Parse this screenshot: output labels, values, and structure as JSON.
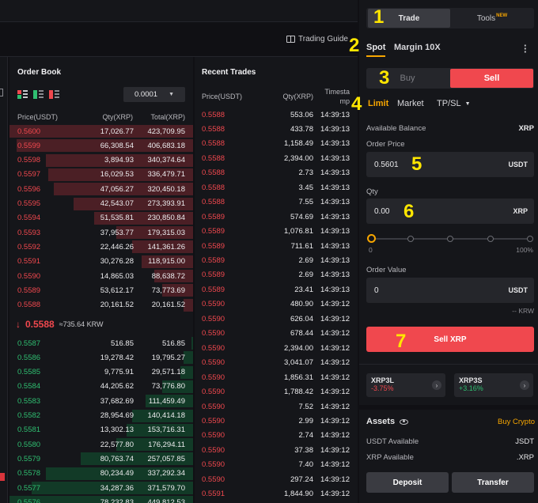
{
  "header": {
    "trading_guide": "Trading Guide"
  },
  "callouts": [
    "1",
    "2",
    "3",
    "4",
    "5",
    "6",
    "7"
  ],
  "order_book": {
    "title": "Order Book",
    "precision": "0.0001",
    "headers": {
      "price": "Price(USDT)",
      "qty": "Qty(XRP)",
      "total": "Total(XRP)"
    },
    "asks": [
      {
        "price": "0.5600",
        "qty": "17,026.77",
        "total": "423,709.95",
        "depth": 1.0
      },
      {
        "price": "0.5599",
        "qty": "66,308.54",
        "total": "406,683.18",
        "depth": 0.96
      },
      {
        "price": "0.5598",
        "qty": "3,894.93",
        "total": "340,374.64",
        "depth": 0.8
      },
      {
        "price": "0.5597",
        "qty": "16,029.53",
        "total": "336,479.71",
        "depth": 0.79
      },
      {
        "price": "0.5596",
        "qty": "47,056.27",
        "total": "320,450.18",
        "depth": 0.76
      },
      {
        "price": "0.5595",
        "qty": "42,543.07",
        "total": "273,393.91",
        "depth": 0.65
      },
      {
        "price": "0.5594",
        "qty": "51,535.81",
        "total": "230,850.84",
        "depth": 0.54
      },
      {
        "price": "0.5593",
        "qty": "37,953.77",
        "total": "179,315.03",
        "depth": 0.42
      },
      {
        "price": "0.5592",
        "qty": "22,446.26",
        "total": "141,361.26",
        "depth": 0.33
      },
      {
        "price": "0.5591",
        "qty": "30,276.28",
        "total": "118,915.00",
        "depth": 0.28
      },
      {
        "price": "0.5590",
        "qty": "14,865.03",
        "total": "88,638.72",
        "depth": 0.21
      },
      {
        "price": "0.5589",
        "qty": "53,612.17",
        "total": "73,773.69",
        "depth": 0.17
      },
      {
        "price": "0.5588",
        "qty": "20,161.52",
        "total": "20,161.52",
        "depth": 0.05
      }
    ],
    "last_price": "0.5588",
    "last_price_fiat": "≈735.64 KRW",
    "bids": [
      {
        "price": "0.5587",
        "qty": "516.85",
        "total": "516.85",
        "depth": 0.01
      },
      {
        "price": "0.5586",
        "qty": "19,278.42",
        "total": "19,795.27",
        "depth": 0.05
      },
      {
        "price": "0.5585",
        "qty": "9,775.91",
        "total": "29,571.18",
        "depth": 0.07
      },
      {
        "price": "0.5584",
        "qty": "44,205.62",
        "total": "73,776.80",
        "depth": 0.17
      },
      {
        "price": "0.5583",
        "qty": "37,682.69",
        "total": "111,459.49",
        "depth": 0.26
      },
      {
        "price": "0.5582",
        "qty": "28,954.69",
        "total": "140,414.18",
        "depth": 0.33
      },
      {
        "price": "0.5581",
        "qty": "13,302.13",
        "total": "153,716.31",
        "depth": 0.36
      },
      {
        "price": "0.5580",
        "qty": "22,577.80",
        "total": "176,294.11",
        "depth": 0.42
      },
      {
        "price": "0.5579",
        "qty": "80,763.74",
        "total": "257,057.85",
        "depth": 0.61
      },
      {
        "price": "0.5578",
        "qty": "80,234.49",
        "total": "337,292.34",
        "depth": 0.8
      },
      {
        "price": "0.5577",
        "qty": "34,287.36",
        "total": "371,579.70",
        "depth": 0.88
      },
      {
        "price": "0.5576",
        "qty": "78,232.83",
        "total": "449,812.53",
        "depth": 1.0
      }
    ]
  },
  "recent_trades": {
    "title": "Recent Trades",
    "headers": {
      "price": "Price(USDT)",
      "qty": "Qty(XRP)",
      "time_line1": "Timesta",
      "time_line2": "mp"
    },
    "rows": [
      {
        "price": "0.5588",
        "qty": "553.06",
        "time": "14:39:13",
        "side": "sell"
      },
      {
        "price": "0.5588",
        "qty": "433.78",
        "time": "14:39:13",
        "side": "sell"
      },
      {
        "price": "0.5588",
        "qty": "1,158.49",
        "time": "14:39:13",
        "side": "sell"
      },
      {
        "price": "0.5588",
        "qty": "2,394.00",
        "time": "14:39:13",
        "side": "sell"
      },
      {
        "price": "0.5588",
        "qty": "2.73",
        "time": "14:39:13",
        "side": "sell"
      },
      {
        "price": "0.5588",
        "qty": "3.45",
        "time": "14:39:13",
        "side": "sell"
      },
      {
        "price": "0.5588",
        "qty": "7.55",
        "time": "14:39:13",
        "side": "sell"
      },
      {
        "price": "0.5589",
        "qty": "574.69",
        "time": "14:39:13",
        "side": "sell"
      },
      {
        "price": "0.5589",
        "qty": "1,076.81",
        "time": "14:39:13",
        "side": "sell"
      },
      {
        "price": "0.5589",
        "qty": "711.61",
        "time": "14:39:13",
        "side": "sell"
      },
      {
        "price": "0.5589",
        "qty": "2.69",
        "time": "14:39:13",
        "side": "sell"
      },
      {
        "price": "0.5589",
        "qty": "2.69",
        "time": "14:39:13",
        "side": "sell"
      },
      {
        "price": "0.5589",
        "qty": "23.41",
        "time": "14:39:13",
        "side": "sell"
      },
      {
        "price": "0.5590",
        "qty": "480.90",
        "time": "14:39:12",
        "side": "sell"
      },
      {
        "price": "0.5590",
        "qty": "626.04",
        "time": "14:39:12",
        "side": "sell"
      },
      {
        "price": "0.5590",
        "qty": "678.44",
        "time": "14:39:12",
        "side": "sell"
      },
      {
        "price": "0.5590",
        "qty": "2,394.00",
        "time": "14:39:12",
        "side": "sell"
      },
      {
        "price": "0.5590",
        "qty": "3,041.07",
        "time": "14:39:12",
        "side": "sell"
      },
      {
        "price": "0.5590",
        "qty": "1,856.31",
        "time": "14:39:12",
        "side": "sell"
      },
      {
        "price": "0.5590",
        "qty": "1,788.42",
        "time": "14:39:12",
        "side": "sell"
      },
      {
        "price": "0.5590",
        "qty": "7.52",
        "time": "14:39:12",
        "side": "sell"
      },
      {
        "price": "0.5590",
        "qty": "2.99",
        "time": "14:39:12",
        "side": "sell"
      },
      {
        "price": "0.5590",
        "qty": "2.74",
        "time": "14:39:12",
        "side": "sell"
      },
      {
        "price": "0.5590",
        "qty": "37.38",
        "time": "14:39:12",
        "side": "sell"
      },
      {
        "price": "0.5590",
        "qty": "7.40",
        "time": "14:39:12",
        "side": "sell"
      },
      {
        "price": "0.5590",
        "qty": "297.24",
        "time": "14:39:12",
        "side": "sell"
      },
      {
        "price": "0.5591",
        "qty": "1,844.90",
        "time": "14:39:12",
        "side": "sell"
      }
    ]
  },
  "panel": {
    "trade_tab": "Trade",
    "tools_tab": "Tools",
    "new_badge": "NEW",
    "spot_tab": "Spot",
    "margin_tab": "Margin 10X",
    "buy": "Buy",
    "sell": "Sell",
    "limit": "Limit",
    "market": "Market",
    "tpsl": "TP/SL",
    "available_balance_label": "Available Balance",
    "available_balance_unit": "XRP",
    "order_price_label": "Order Price",
    "order_price_value": "0.5601",
    "order_price_unit": "USDT",
    "qty_label": "Qty",
    "qty_value": "0.00",
    "qty_unit": "XRP",
    "slider_min": "0",
    "slider_max": "100%",
    "slider_value": 0,
    "order_value_label": "Order Value",
    "order_value_value": "0",
    "order_value_unit": "USDT",
    "order_value_fiat": "-- KRW",
    "sell_button": "Sell XRP",
    "etf_down_name": "XRP3L",
    "etf_down_change": "-3.75%",
    "etf_up_name": "XRP3S",
    "etf_up_change": "+3.16%",
    "assets_title": "Assets",
    "buy_crypto": "Buy Crypto",
    "usdt_available_label": "USDT Available",
    "usdt_available_value": "JSDT",
    "xrp_available_label": "XRP Available",
    "xrp_available_value": ".XRP",
    "deposit": "Deposit",
    "transfer": "Transfer"
  },
  "colors": {
    "sell": "#f0484e",
    "buy": "#2fbf71",
    "accent": "#f7a600"
  }
}
